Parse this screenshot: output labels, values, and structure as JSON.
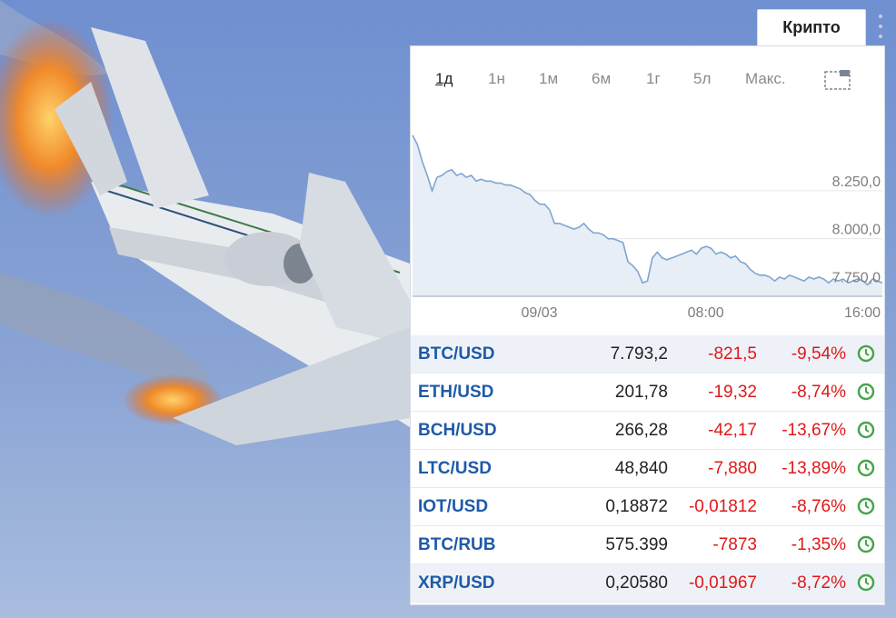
{
  "tab": {
    "label": "Крипто"
  },
  "periods": [
    "1д",
    "1н",
    "1м",
    "6м",
    "1г",
    "5л",
    "Макс."
  ],
  "active_period": "1д",
  "colors": {
    "line": "#7fa6cf",
    "fill": "#e7eef6",
    "symbol": "#1e5aa8",
    "negative": "#e01818",
    "clock": "#49a44b"
  },
  "chart_data": {
    "type": "area",
    "x_ticks": [
      "09/03",
      "08:00",
      "16:00"
    ],
    "y_ticks": [
      "8.250,0",
      "8.000,0",
      "7.750,0"
    ],
    "ylim": [
      7700,
      8600
    ],
    "x_range": [
      0,
      96
    ],
    "x_tick_positions": [
      30,
      64,
      96
    ],
    "y_tick_values": [
      8250,
      8000,
      7750
    ],
    "series": [
      {
        "x": [
          0,
          1,
          2,
          3,
          4,
          5,
          6,
          7,
          8,
          9,
          10,
          11,
          12,
          13,
          14,
          15,
          16,
          17,
          18,
          19,
          20,
          21,
          22,
          23,
          24,
          25,
          26,
          27,
          28,
          29,
          30,
          31,
          32,
          33,
          34,
          35,
          36,
          37,
          38,
          39,
          40,
          41,
          42,
          43,
          44,
          45,
          46,
          47,
          48,
          49,
          50,
          51,
          52,
          53,
          54,
          55,
          56,
          57,
          58,
          59,
          60,
          61,
          62,
          63,
          64,
          65,
          66,
          67,
          68,
          69,
          70,
          71,
          72,
          73,
          74,
          75,
          76,
          77,
          78,
          79,
          80,
          81,
          82,
          83,
          84,
          85,
          86,
          87,
          88,
          89,
          90,
          91,
          92,
          93,
          94,
          95,
          96
        ],
        "y": [
          8540,
          8490,
          8400,
          8330,
          8250,
          8320,
          8330,
          8350,
          8360,
          8330,
          8340,
          8320,
          8330,
          8300,
          8310,
          8300,
          8300,
          8290,
          8290,
          8280,
          8280,
          8270,
          8260,
          8240,
          8230,
          8200,
          8180,
          8180,
          8150,
          8080,
          8080,
          8070,
          8060,
          8050,
          8060,
          8080,
          8050,
          8030,
          8030,
          8020,
          8000,
          8000,
          7990,
          7980,
          7880,
          7860,
          7830,
          7770,
          7780,
          7900,
          7930,
          7900,
          7890,
          7900,
          7910,
          7920,
          7930,
          7940,
          7920,
          7950,
          7960,
          7950,
          7920,
          7930,
          7920,
          7900,
          7910,
          7880,
          7870,
          7840,
          7820,
          7810,
          7810,
          7800,
          7780,
          7800,
          7790,
          7810,
          7800,
          7790,
          7780,
          7800,
          7790,
          7800,
          7790,
          7770,
          7790,
          7780,
          7790,
          7770,
          7780,
          7790,
          7780,
          7760,
          7790,
          7780,
          7770
        ]
      }
    ]
  },
  "rows": [
    {
      "symbol": "BTC/USD",
      "price": "7.793,2",
      "change": "-821,5",
      "percent": "-9,54%"
    },
    {
      "symbol": "ETH/USD",
      "price": "201,78",
      "change": "-19,32",
      "percent": "-8,74%"
    },
    {
      "symbol": "BCH/USD",
      "price": "266,28",
      "change": "-42,17",
      "percent": "-13,67%"
    },
    {
      "symbol": "LTC/USD",
      "price": "48,840",
      "change": "-7,880",
      "percent": "-13,89%"
    },
    {
      "symbol": "IOT/USD",
      "price": "0,18872",
      "change": "-0,01812",
      "percent": "-8,76%"
    },
    {
      "symbol": "BTC/RUB",
      "price": "575.399",
      "change": "-7873",
      "percent": "-1,35%"
    },
    {
      "symbol": "XRP/USD",
      "price": "0,20580",
      "change": "-0,01967",
      "percent": "-8,72%"
    }
  ]
}
